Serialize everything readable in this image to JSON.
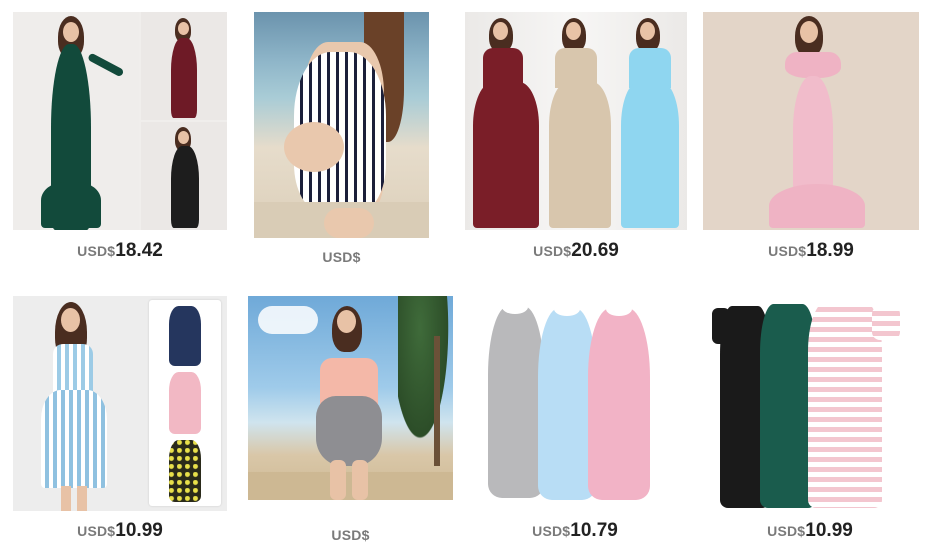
{
  "products": [
    {
      "currency": "USD$",
      "amount": "18.42",
      "image": "green-mermaid-maternity-gown-photo",
      "colors": [
        "#134a3a",
        "#6e1a26",
        "#1d1d1d"
      ]
    },
    {
      "currency": "USD$",
      "amount": "",
      "image": "striped-maternity-swimsuit-photo",
      "colors": [
        "#ffffff",
        "#1b1f3a"
      ]
    },
    {
      "currency": "USD$",
      "amount": "20.69",
      "image": "off-shoulder-maternity-dresses-photo",
      "colors": [
        "#7a1e28",
        "#d8c6ad",
        "#8fd6f0"
      ]
    },
    {
      "currency": "USD$",
      "amount": "18.99",
      "image": "pink-ruffle-maternity-gown-photo",
      "colors": [
        "#efb3c4"
      ]
    },
    {
      "currency": "USD$",
      "amount": "10.99",
      "image": "striped-nursing-dress-photo",
      "colors": [
        "#9ccbe6",
        "#25365e",
        "#f2b8c4",
        "#2a2a1a"
      ]
    },
    {
      "currency": "USD$",
      "amount": "",
      "image": "pink-grey-maternity-swimsuit-photo",
      "colors": [
        "#f4b8a8",
        "#8e8e92"
      ]
    },
    {
      "currency": "USD$",
      "amount": "10.79",
      "image": "tank-maternity-dresses-photo",
      "colors": [
        "#b9b9bb",
        "#b8ddf5",
        "#f2b3c6"
      ]
    },
    {
      "currency": "USD$",
      "amount": "10.99",
      "image": "tshirt-maternity-dresses-photo",
      "colors": [
        "#1a1a1a",
        "#1a5c4d",
        "#f3c6cf"
      ]
    }
  ]
}
